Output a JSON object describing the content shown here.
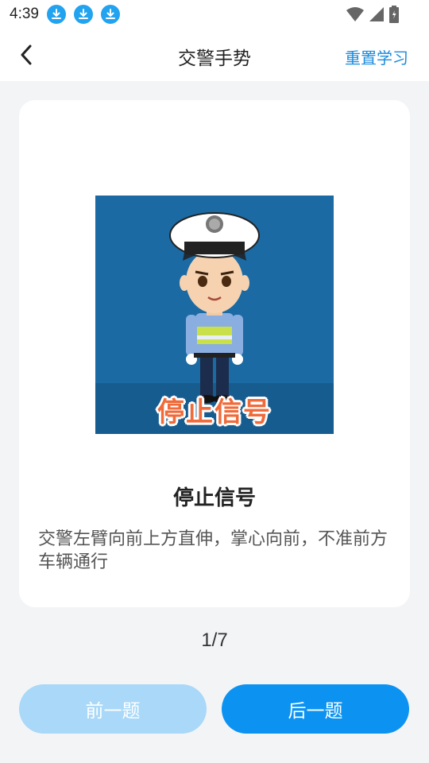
{
  "status": {
    "time": "4:39",
    "icons": [
      "download-icon",
      "download-icon",
      "download-icon",
      "wifi-icon",
      "signal-icon",
      "battery-icon"
    ]
  },
  "header": {
    "title": "交警手势",
    "reset_label": "重置学习"
  },
  "lesson": {
    "image_caption": "停止信号",
    "title": "停止信号",
    "description": "交警左臂向前上方直伸，掌心向前，不准前方车辆通行"
  },
  "pager": {
    "text": "1/7"
  },
  "buttons": {
    "prev_label": "前一题",
    "next_label": "后一题"
  },
  "colors": {
    "accent": "#0c93f2",
    "accent_disabled": "#a9d8f8",
    "link": "#1a8bdc",
    "image_bg": "#1b6aa3"
  }
}
